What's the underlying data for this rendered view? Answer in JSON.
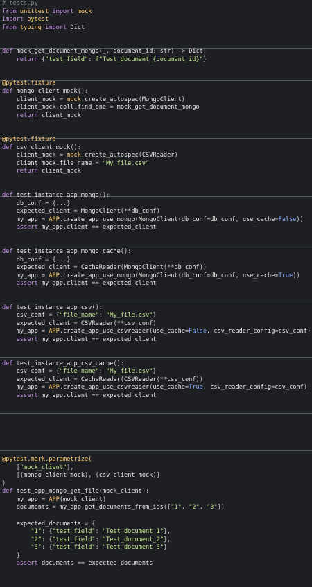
{
  "app": {
    "file_name": "# tests.py"
  },
  "code": {
    "lines": [
      "# tests.py",
      "from unittest import mock",
      "import pytest",
      "from typing import Dict",
      "",
      "",
      "def mock_get_document_mongo(_, document_id: str) -> Dict:",
      "    return {\"test_field\": f\"Test_document_{document_id}\"}",
      "",
      "",
      "@pytest.fixture",
      "def mongo_client_mock():",
      "    client_mock = mock.create_autospec(MongoClient)",
      "    client_mock.coll.find_one = mock_get_document_mongo",
      "    return client_mock",
      "",
      "",
      "@pytest.fixture",
      "def csv_client_mock():",
      "    client_mock = mock.create_autospec(CSVReader)",
      "    client_mock.file_name = \"My_file.csv\"",
      "    return client_mock",
      "",
      "",
      "def test_instance_app_mongo():",
      "    db_conf = {...}",
      "    expected_client = MongoClient(**db_conf)",
      "    my_app = APP.create_app_use_mongo(MongoClient(db_conf=db_conf, use_cache=False))",
      "    assert my_app.client == expected_client",
      "",
      "",
      "def test_instance_app_mongo_cache():",
      "    db_conf = {...}",
      "    expected_client = CacheReader(MongoClient(**db_conf))",
      "    my_app = APP.create_app_use_mongo(MongoClient(db_conf=db_conf, use_cache=True))",
      "    assert my_app.client == expected_client",
      "",
      "",
      "def test_instance_app_csv():",
      "    csv_conf = {\"file_name\": \"My_file.csv\"}",
      "    expected_client = CSVReader(**csv_conf)",
      "    my_app = APP.create_app_use_csvreader(use_cache=False, csv_reader_config=csv_conf)",
      "    assert my_app.client == expected_client",
      "",
      "",
      "def test_instance_app_csv_cache():",
      "    csv_conf = {\"file_name\": \"My_file.csv\"}",
      "    expected_client = CacheReader(CSVReader(**csv_conf))",
      "    my_app = APP.create_app_use_csvreader(use_cache=True, csv_reader_config=csv_conf)",
      "    assert my_app.client == expected_client",
      "",
      "",
      "",
      "",
      "",
      "",
      "",
      "@pytest.mark.parametrize(",
      "    [\"mock_client\"],",
      "    [(mongo_client_mock), (csv_client_mock)]",
      ")",
      "def test_app_mongo_get_file(mock_client):",
      "    my_app = APP(mock_client)",
      "    documents = my_app.get_documents_from_ids([\"1\", \"2\", \"3\"])",
      "",
      "    expected_documents = {",
      "        \"1\": {\"test_field\": \"Test_document_1\"},",
      "        \"2\": {\"test_field\": \"Test_document_2\"},",
      "        \"3\": {\"test_field\": \"Test_document_3\"}",
      "    }",
      "    assert documents == expected_documents",
      "",
      ""
    ]
  },
  "theme": {
    "background": "#1e1f22",
    "keyword": "#c678dd",
    "string": "#c3e88d",
    "comment": "#7f848e",
    "decorator": "#ffcb6b"
  }
}
